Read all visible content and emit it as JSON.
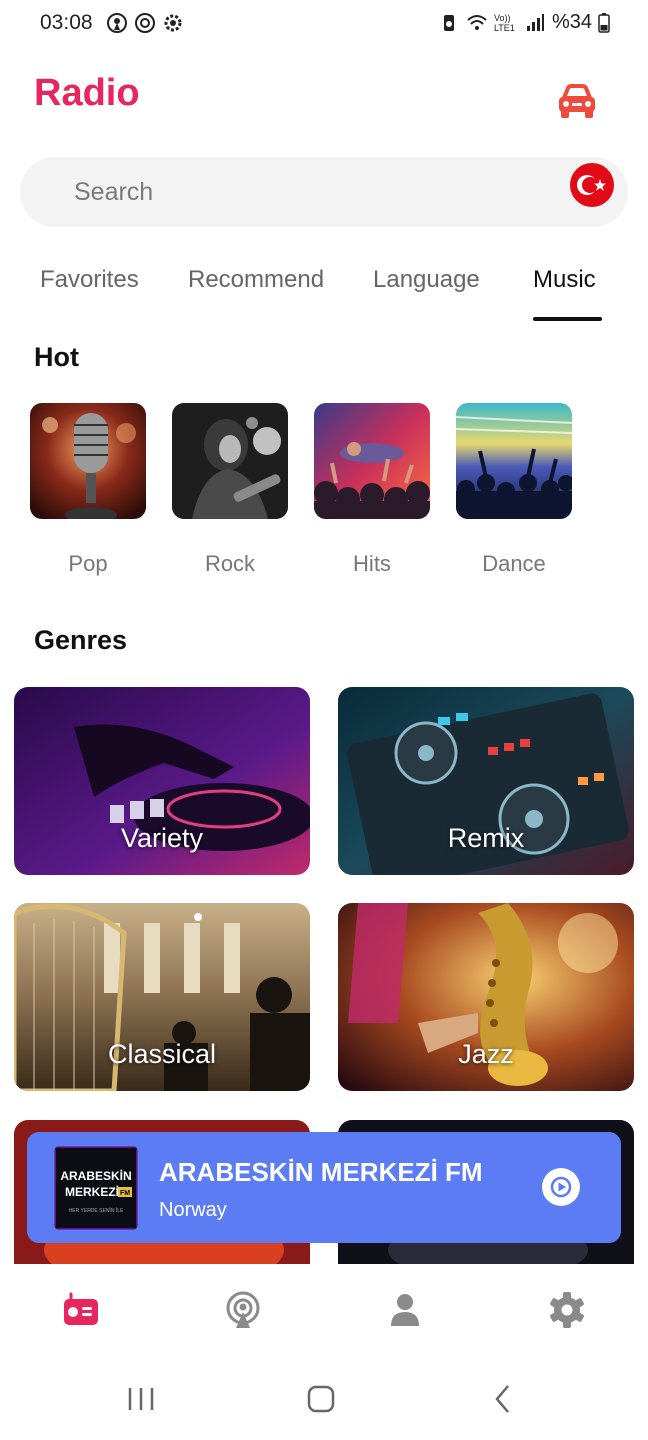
{
  "status_bar": {
    "time": "03:08",
    "network": "Vo)) LTE1",
    "battery": "%34"
  },
  "header": {
    "title": "Radio",
    "car_mode_icon": "car-icon",
    "accent_color": "#e8265e"
  },
  "search": {
    "placeholder": "Search",
    "country_icon": "turkey-flag-icon"
  },
  "tabs": [
    {
      "label": "Favorites",
      "active": false
    },
    {
      "label": "Recommend",
      "active": false
    },
    {
      "label": "Language",
      "active": false
    },
    {
      "label": "Music",
      "active": true
    }
  ],
  "hot": {
    "title": "Hot",
    "items": [
      {
        "label": "Pop"
      },
      {
        "label": "Rock"
      },
      {
        "label": "Hits"
      },
      {
        "label": "Dance"
      }
    ]
  },
  "genres": {
    "title": "Genres",
    "items": [
      {
        "label": "Variety"
      },
      {
        "label": "Remix"
      },
      {
        "label": "Classical"
      },
      {
        "label": "Jazz"
      }
    ]
  },
  "now_playing": {
    "station": "ARABESKİN MERKEZİ FM",
    "country": "Norway",
    "logo_text_1": "ARABESKİN",
    "logo_text_2": "MERKEZİ",
    "logo_badge": "FM",
    "logo_tagline": "HER YERDE SENİN İLE",
    "color": "#5b7cf2"
  },
  "bottom_nav": [
    {
      "icon": "radio-icon",
      "active": true
    },
    {
      "icon": "podcast-icon",
      "active": false
    },
    {
      "icon": "profile-icon",
      "active": false
    },
    {
      "icon": "settings-icon",
      "active": false
    }
  ]
}
